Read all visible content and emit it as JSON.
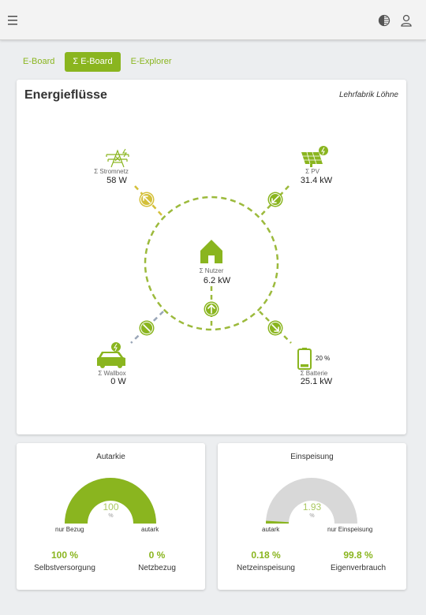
{
  "header": {
    "menu_icon": "menu-icon",
    "theme_icon": "contrast-icon",
    "user_icon": "user-icon"
  },
  "tabs": [
    {
      "label": "E-Board",
      "active": false
    },
    {
      "label": "Σ E-Board",
      "active": true
    },
    {
      "label": "E-Explorer",
      "active": false
    }
  ],
  "energy": {
    "title": "Energieflüsse",
    "location": "Lehrfabrik Löhne",
    "grid": {
      "label": "Σ Stromnetz",
      "value": "58 W",
      "icon": "power-tower-icon"
    },
    "pv": {
      "label": "Σ PV",
      "value": "31.4 kW",
      "icon": "solar-panel-icon"
    },
    "consumer": {
      "label": "Σ Nutzer",
      "value": "6.2 kW",
      "icon": "house-icon"
    },
    "wallbox": {
      "label": "Σ Wallbox",
      "value": "0 W",
      "icon": "electric-car-icon"
    },
    "battery": {
      "label": "Σ Batterie",
      "value": "25.1 kW",
      "charge": "20 %",
      "icon": "battery-icon"
    }
  },
  "autarkie": {
    "title": "Autarkie",
    "value": "100",
    "unit": "%",
    "fraction": 1.0,
    "left_label": "nur Bezug",
    "right_label": "autark",
    "stat1_value": "100 %",
    "stat1_label": "Selbstversorgung",
    "stat2_value": "0 %",
    "stat2_label": "Netzbezug"
  },
  "einspeisung": {
    "title": "Einspeisung",
    "value": "1.93",
    "unit": "%",
    "fraction": 0.0193,
    "left_label": "autark",
    "right_label": "nur Einspeisung",
    "stat1_value": "0.18 %",
    "stat1_label": "Netzeinspeisung",
    "stat2_value": "99.8 %",
    "stat2_label": "Eigenverbrauch"
  },
  "colors": {
    "accent": "#8ab51f",
    "grid_marker": "#d4c03a",
    "gauge_bg": "#d8d8d8",
    "link_grey": "#9aa6b8"
  }
}
